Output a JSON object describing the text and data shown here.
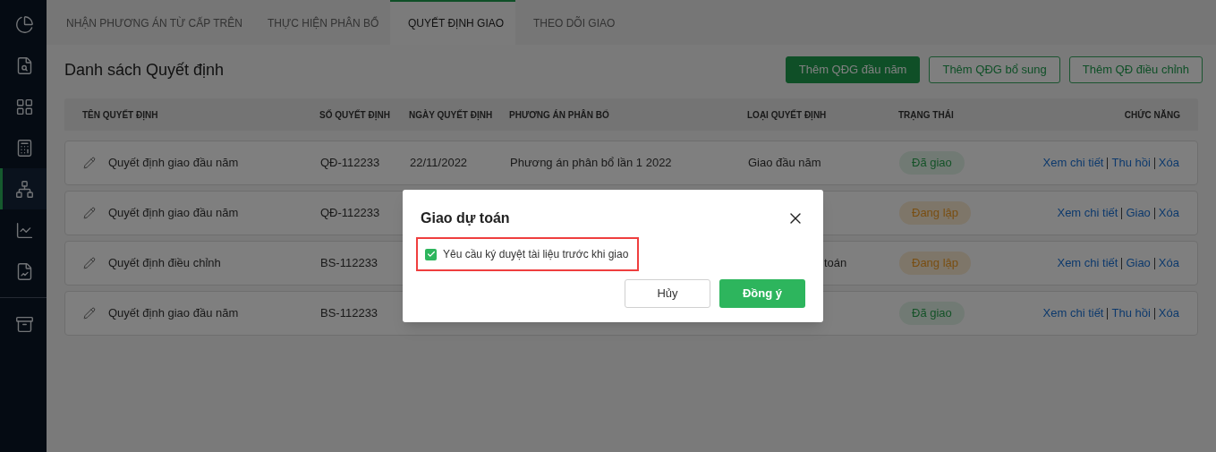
{
  "sidebar": {
    "items": [
      {
        "selected": false
      },
      {
        "selected": false
      },
      {
        "selected": false
      },
      {
        "selected": false
      },
      {
        "selected": true
      },
      {
        "selected": false
      },
      {
        "selected": false
      },
      {
        "selected": false
      }
    ]
  },
  "tabs": [
    {
      "label": "NHẬN PHƯƠNG ÁN TỪ CẤP TRÊN",
      "selected": false
    },
    {
      "label": "THỰC HIỆN PHÂN BỔ",
      "selected": false
    },
    {
      "label": "QUYẾT ĐỊNH GIAO",
      "selected": true
    },
    {
      "label": "THEO DÕI GIAO",
      "selected": false
    }
  ],
  "title": "Danh sách Quyết định",
  "buttons": [
    {
      "label": "Thêm QĐG đầu năm",
      "kind": "primary"
    },
    {
      "label": "Thêm QĐG bổ sung",
      "kind": "outline"
    },
    {
      "label": "Thêm QĐ điều chỉnh",
      "kind": "outline"
    }
  ],
  "table": {
    "columns": [
      "TÊN QUYẾT ĐỊNH",
      "SỐ QUYẾT ĐỊNH",
      "NGÀY QUYẾT ĐỊNH",
      "PHƯƠNG ÁN PHÂN BỔ",
      "LOẠI QUYẾT ĐỊNH",
      "TRẠNG THÁI",
      "CHỨC NĂNG"
    ],
    "rows": [
      {
        "name": "Quyết định giao đầu năm",
        "number": "QĐ-112233",
        "date": "22/11/2022",
        "plan": "Phương án phân bổ lần 1 2022",
        "type": "Giao đầu năm",
        "status": {
          "label": "Đã giao",
          "kind": "done"
        },
        "actions": [
          "Xem chi tiết",
          "Thu hồi",
          "Xóa"
        ]
      },
      {
        "name": "Quyết định giao đầu năm",
        "number": "QĐ-112233",
        "status": {
          "label": "Đang lập",
          "kind": "draft"
        },
        "actions": [
          "Xem chi tiết",
          "Giao",
          "Xóa"
        ]
      },
      {
        "name": "Quyết định điều chỉnh",
        "number": "BS-112233",
        "type_tail": "toán",
        "status": {
          "label": "Đang lập",
          "kind": "draft"
        },
        "actions": [
          "Xem chi tiết",
          "Giao",
          "Xóa"
        ]
      },
      {
        "name": "Quyết định giao đầu năm",
        "number": "BS-112233",
        "status": {
          "label": "Đã giao",
          "kind": "done"
        },
        "actions": [
          "Xem chi tiết",
          "Thu hồi",
          "Xóa"
        ]
      }
    ]
  },
  "dialog": {
    "title": "Giao dự toán",
    "checkbox": {
      "label": "Yêu cầu ký duyệt tài liệu trước khi giao",
      "checked": true
    },
    "buttons": [
      {
        "label": "Hủy",
        "kind": "secondary"
      },
      {
        "label": "Đồng ý",
        "kind": "primary"
      }
    ]
  }
}
